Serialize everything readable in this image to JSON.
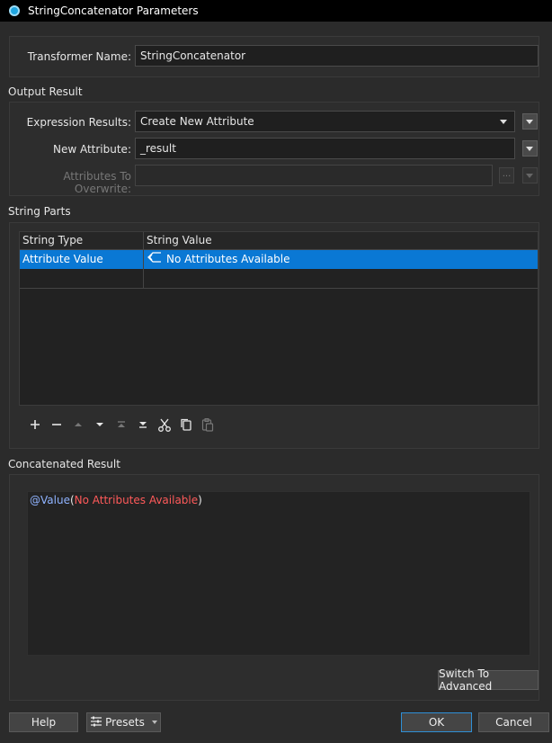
{
  "window": {
    "title": "StringConcatenator Parameters"
  },
  "transformer": {
    "label": "Transformer Name:",
    "value": "StringConcatenator"
  },
  "output": {
    "section_title": "Output Result",
    "expression_label": "Expression Results:",
    "expression_value": "Create New Attribute",
    "new_attr_label": "New Attribute:",
    "new_attr_value": "_result",
    "overwrite_label": "Attributes To Overwrite:",
    "overwrite_value": "",
    "ellipsis": "..."
  },
  "parts": {
    "section_title": "String Parts",
    "columns": [
      "String Type",
      "String Value"
    ],
    "rows": [
      {
        "type": "Attribute Value",
        "value": "No Attributes Available",
        "selected": true
      },
      {
        "type": "",
        "value": "",
        "selected": false
      }
    ],
    "toolbar": [
      "add-icon",
      "remove-icon",
      "move-up-icon",
      "move-down-icon",
      "move-bottom-icon",
      "move-top-icon",
      "cut-icon",
      "copy-icon",
      "paste-icon"
    ]
  },
  "result": {
    "section_title": "Concatenated Result",
    "func": "@Value",
    "open": "(",
    "arg": "No Attributes Available",
    "close": ")",
    "switch_button": "Switch To Advanced"
  },
  "footer": {
    "help": "Help",
    "presets": "Presets",
    "ok": "OK",
    "cancel": "Cancel"
  },
  "colors": {
    "accent": "#1e7ad6",
    "selection": "#0a78d4",
    "func_color": "#8fb3ff",
    "arg_color": "#ff5a5a"
  }
}
